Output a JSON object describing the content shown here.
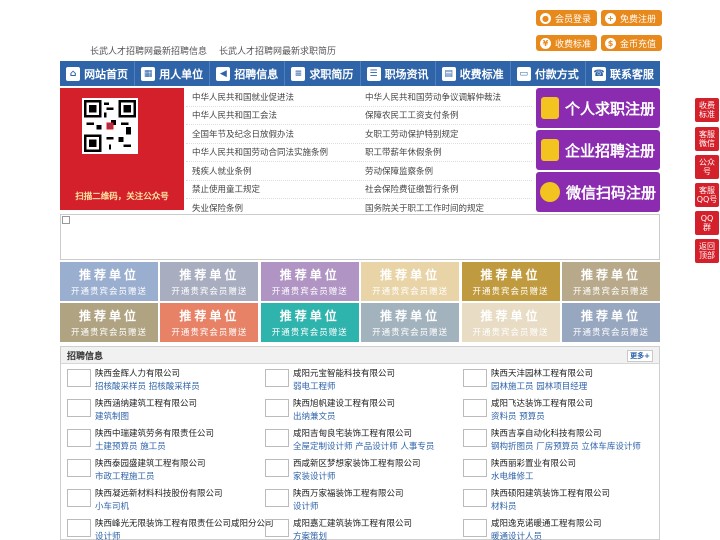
{
  "top_links": [
    "长武人才招聘网最新招聘信息",
    "长武人才招聘网最新求职简历"
  ],
  "top_buttons": {
    "login": "会员登录",
    "register": "免费注册",
    "fee": "收费标准",
    "recharge": "金币充值"
  },
  "nav": [
    {
      "label": "网站首页",
      "icon": "home-icon"
    },
    {
      "label": "用人单位",
      "icon": "building-icon"
    },
    {
      "label": "招聘信息",
      "icon": "megaphone-icon"
    },
    {
      "label": "求职简历",
      "icon": "resume-icon"
    },
    {
      "label": "职场资讯",
      "icon": "news-icon"
    },
    {
      "label": "收费标准",
      "icon": "price-icon"
    },
    {
      "label": "付款方式",
      "icon": "payment-icon"
    },
    {
      "label": "联系客服",
      "icon": "phone-icon"
    }
  ],
  "qr_caption": "扫描二维码，关注公众号",
  "laws": [
    [
      "中华人民共和国就业促进法",
      "中华人民共和国劳动争议调解仲裁法"
    ],
    [
      "中华人民共和国工会法",
      "保障农民工工资支付条例"
    ],
    [
      "全国年节及纪念日放假办法",
      "女职工劳动保护特别规定"
    ],
    [
      "中华人民共和国劳动合同法实施条例",
      "职工带薪年休假条例"
    ],
    [
      "残疾人就业条例",
      "劳动保障监察条例"
    ],
    [
      "禁止使用童工规定",
      "社会保险费征缴暂行条例"
    ],
    [
      "失业保险条例",
      "国务院关于职工工作时间的规定"
    ]
  ],
  "register_buttons": [
    "个人求职注册",
    "企业招聘注册",
    "微信扫码注册"
  ],
  "float_buttons": [
    "收费\n标准",
    "客服\n微信",
    "公众\n号",
    "客服\nQQ号",
    "QQ\n群",
    "返回\n顶部"
  ],
  "tiles": {
    "title": "推荐单位",
    "subtitle": "开通贵宾会员赠送",
    "colors": [
      "#9aaed0",
      "#a8aec0",
      "#b094c3",
      "#e9d4a8",
      "#c09a3e",
      "#b8a98a",
      "#b0a382",
      "#e78267",
      "#2fb3ad",
      "#a3b3be",
      "#e8dcc4",
      "#98a7c0"
    ]
  },
  "recruit": {
    "title": "招聘信息",
    "more": "更多+",
    "items": [
      {
        "company": "陕西金辉人力有限公司",
        "jobs": "招核酸采样员 招核酸采样员"
      },
      {
        "company": "咸阳元宝智能科技有限公司",
        "jobs": "弱电工程师"
      },
      {
        "company": "陕西天沣园林工程有限公司",
        "jobs": "园林施工员 园林项目经理"
      },
      {
        "company": "陕西涵纳建筑工程有限公司",
        "jobs": "建筑制图"
      },
      {
        "company": "陕西旭帆建设工程有限公司",
        "jobs": "出纳兼文员"
      },
      {
        "company": "咸阳飞达装饰工程有限公司",
        "jobs": "资料员 预算员"
      },
      {
        "company": "陕西中瑞建筑劳务有限责任公司",
        "jobs": "土建预算员 施工员"
      },
      {
        "company": "咸阳吉甸良宅装饰工程有限公司",
        "jobs": "全屋定制设计师 产品设计师 人事专员"
      },
      {
        "company": "陕西吉享自动化科技有限公司",
        "jobs": "钢构折图员 厂房预算员 立体车库设计师"
      },
      {
        "company": "陕西泰园盛建筑工程有限公司",
        "jobs": "市政工程施工员"
      },
      {
        "company": "西咸新区梦想家装饰工程有限公司",
        "jobs": "家装设计师"
      },
      {
        "company": "陕西丽彩置业有限公司",
        "jobs": "水电维修工"
      },
      {
        "company": "陕西凝远新材料科技股份有限公司",
        "jobs": "小车司机"
      },
      {
        "company": "陕西万家福装饰工程有限公司",
        "jobs": "设计师"
      },
      {
        "company": "陕西硕阳建筑装饰工程有限公司",
        "jobs": "材料员"
      },
      {
        "company": "陕西峰光无限装饰工程有限责任公司咸阳分公司",
        "jobs": "设计师"
      },
      {
        "company": "咸阳嘉汇建筑装饰工程有限公司",
        "jobs": "方案策划"
      },
      {
        "company": "咸阳逸克诺暖通工程有限公司",
        "jobs": "暖通设计人员"
      }
    ]
  }
}
